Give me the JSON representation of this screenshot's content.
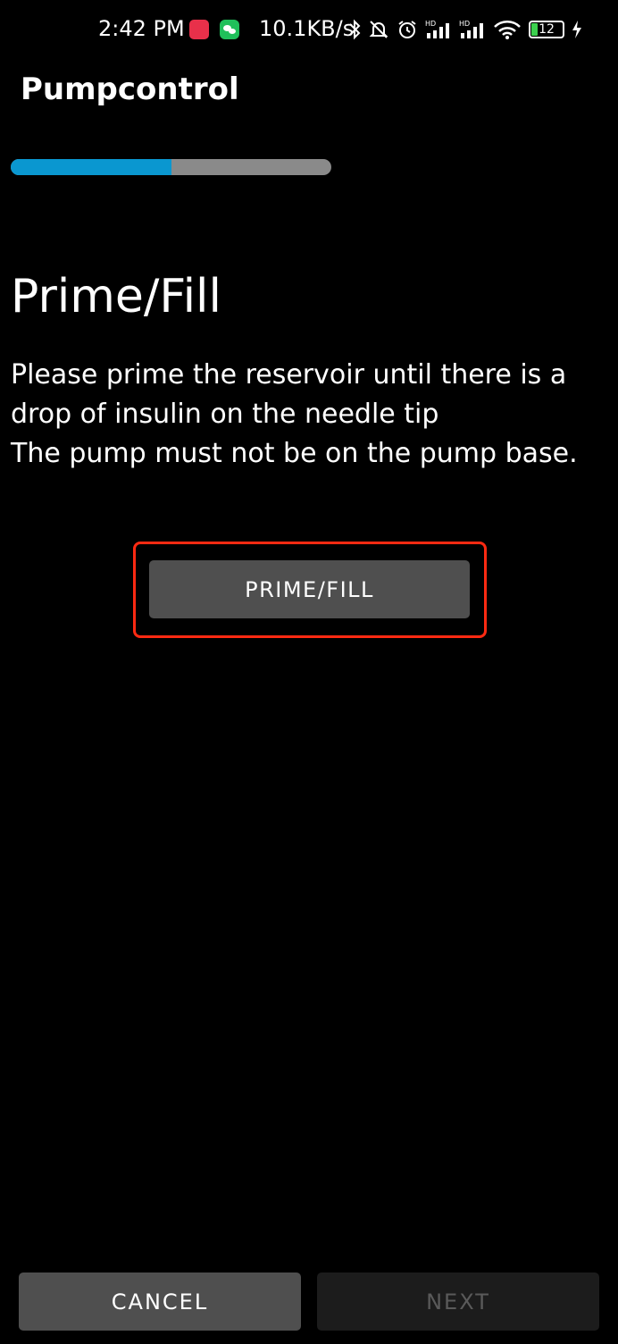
{
  "status_bar": {
    "time": "2:42 PM",
    "network_speed": "10.1KB/s",
    "battery_level": "12",
    "icons": [
      "app-notification-icon",
      "wechat-icon",
      "bluetooth-icon",
      "mute-bell-icon",
      "alarm-icon",
      "signal-hd-icon",
      "signal-hd-icon",
      "wifi-icon",
      "battery-icon",
      "charging-icon"
    ]
  },
  "app_bar": {
    "title": "Pumpcontrol"
  },
  "progress": {
    "value_fraction": 0.5,
    "color": "#0a97d0",
    "track_color": "#8a8a8a"
  },
  "content": {
    "heading": "Prime/Fill",
    "instruction_lines": [
      "Please prime the reservoir until there is a",
      "drop of insulin on the needle tip",
      "The pump must not be on the pump base."
    ],
    "prime_button_label": "PRIME/FILL",
    "highlight_color": "#ff2a12"
  },
  "footer": {
    "cancel_label": "CANCEL",
    "next_label": "NEXT"
  }
}
